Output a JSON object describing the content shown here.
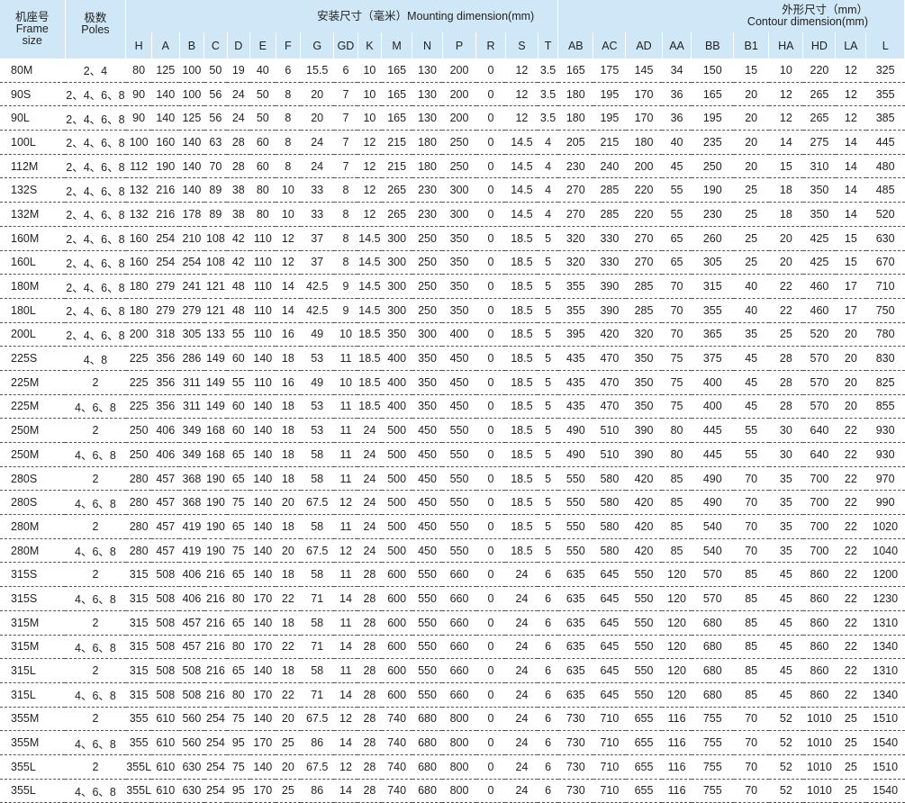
{
  "header": {
    "frame_label": "机座号\nFrame\nsize",
    "poles_label": "极数\nPoles",
    "mounting_label": "安装尺寸（毫米）Mounting dimension(mm)",
    "contour_label": "外形尺寸（mm）\nContour dimension(mm)",
    "mounting_columns": [
      "H",
      "A",
      "B",
      "C",
      "D",
      "E",
      "F",
      "G",
      "GD",
      "K",
      "M",
      "N",
      "P",
      "R",
      "S",
      "T"
    ],
    "contour_columns": [
      "AB",
      "AC",
      "AD",
      "AA",
      "BB",
      "B1",
      "HA",
      "HD",
      "LA",
      "L"
    ]
  },
  "rows": [
    [
      "80M",
      "2、4",
      "80",
      "125",
      "100",
      "50",
      "19",
      "40",
      "6",
      "15.5",
      "6",
      "10",
      "165",
      "130",
      "200",
      "0",
      "12",
      "3.5",
      "165",
      "175",
      "145",
      "34",
      "150",
      "15",
      "10",
      "220",
      "12",
      "325"
    ],
    [
      "90S",
      "2、4、6、8",
      "90",
      "140",
      "100",
      "56",
      "24",
      "50",
      "8",
      "20",
      "7",
      "10",
      "165",
      "130",
      "200",
      "0",
      "12",
      "3.5",
      "180",
      "195",
      "170",
      "36",
      "165",
      "20",
      "12",
      "265",
      "12",
      "355"
    ],
    [
      "90L",
      "2、4、6、8",
      "90",
      "140",
      "125",
      "56",
      "24",
      "50",
      "8",
      "20",
      "7",
      "10",
      "165",
      "130",
      "200",
      "0",
      "12",
      "3.5",
      "180",
      "195",
      "170",
      "36",
      "195",
      "20",
      "12",
      "265",
      "12",
      "385"
    ],
    [
      "100L",
      "2、4、6、8",
      "100",
      "160",
      "140",
      "63",
      "28",
      "60",
      "8",
      "24",
      "7",
      "12",
      "215",
      "180",
      "250",
      "0",
      "14.5",
      "4",
      "205",
      "215",
      "180",
      "40",
      "235",
      "20",
      "14",
      "275",
      "14",
      "445"
    ],
    [
      "112M",
      "2、4、6、8",
      "112",
      "190",
      "140",
      "70",
      "28",
      "60",
      "8",
      "24",
      "7",
      "12",
      "215",
      "180",
      "250",
      "0",
      "14.5",
      "4",
      "230",
      "240",
      "200",
      "45",
      "250",
      "20",
      "15",
      "310",
      "14",
      "480"
    ],
    [
      "132S",
      "2、4、6、8",
      "132",
      "216",
      "140",
      "89",
      "38",
      "80",
      "10",
      "33",
      "8",
      "12",
      "265",
      "230",
      "300",
      "0",
      "14.5",
      "4",
      "270",
      "285",
      "220",
      "55",
      "190",
      "25",
      "18",
      "350",
      "14",
      "485"
    ],
    [
      "132M",
      "2、4、6、8",
      "132",
      "216",
      "178",
      "89",
      "38",
      "80",
      "10",
      "33",
      "8",
      "12",
      "265",
      "230",
      "300",
      "0",
      "14.5",
      "4",
      "270",
      "285",
      "220",
      "55",
      "230",
      "25",
      "18",
      "350",
      "14",
      "520"
    ],
    [
      "160M",
      "2、4、6、8",
      "160",
      "254",
      "210",
      "108",
      "42",
      "110",
      "12",
      "37",
      "8",
      "14.5",
      "300",
      "250",
      "350",
      "0",
      "18.5",
      "5",
      "320",
      "330",
      "270",
      "65",
      "260",
      "25",
      "20",
      "425",
      "15",
      "630"
    ],
    [
      "160L",
      "2、4、6、8",
      "160",
      "254",
      "254",
      "108",
      "42",
      "110",
      "12",
      "37",
      "8",
      "14.5",
      "300",
      "250",
      "350",
      "0",
      "18.5",
      "5",
      "320",
      "330",
      "270",
      "65",
      "305",
      "25",
      "20",
      "425",
      "15",
      "670"
    ],
    [
      "180M",
      "2、4、6、8",
      "180",
      "279",
      "241",
      "121",
      "48",
      "110",
      "14",
      "42.5",
      "9",
      "14.5",
      "300",
      "250",
      "350",
      "0",
      "18.5",
      "5",
      "355",
      "390",
      "285",
      "70",
      "315",
      "40",
      "22",
      "460",
      "17",
      "710"
    ],
    [
      "180L",
      "2、4、6、8",
      "180",
      "279",
      "279",
      "121",
      "48",
      "110",
      "14",
      "42.5",
      "9",
      "14.5",
      "300",
      "250",
      "350",
      "0",
      "18.5",
      "5",
      "355",
      "390",
      "285",
      "70",
      "355",
      "40",
      "22",
      "460",
      "17",
      "750"
    ],
    [
      "200L",
      "2、4、6、8",
      "200",
      "318",
      "305",
      "133",
      "55",
      "110",
      "16",
      "49",
      "10",
      "18.5",
      "350",
      "300",
      "400",
      "0",
      "18.5",
      "5",
      "395",
      "420",
      "320",
      "70",
      "365",
      "35",
      "25",
      "520",
      "20",
      "780"
    ],
    [
      "225S",
      "4、8",
      "225",
      "356",
      "286",
      "149",
      "60",
      "140",
      "18",
      "53",
      "11",
      "18.5",
      "400",
      "350",
      "450",
      "0",
      "18.5",
      "5",
      "435",
      "470",
      "350",
      "75",
      "375",
      "45",
      "28",
      "570",
      "20",
      "830"
    ],
    [
      "225M",
      "2",
      "225",
      "356",
      "311",
      "149",
      "55",
      "110",
      "16",
      "49",
      "10",
      "18.5",
      "400",
      "350",
      "450",
      "0",
      "18.5",
      "5",
      "435",
      "470",
      "350",
      "75",
      "400",
      "45",
      "28",
      "570",
      "20",
      "825"
    ],
    [
      "225M",
      "4、6、8",
      "225",
      "356",
      "311",
      "149",
      "60",
      "140",
      "18",
      "53",
      "11",
      "18.5",
      "400",
      "350",
      "450",
      "0",
      "18.5",
      "5",
      "435",
      "470",
      "350",
      "75",
      "400",
      "45",
      "28",
      "570",
      "20",
      "855"
    ],
    [
      "250M",
      "2",
      "250",
      "406",
      "349",
      "168",
      "60",
      "140",
      "18",
      "53",
      "11",
      "24",
      "500",
      "450",
      "550",
      "0",
      "18.5",
      "5",
      "490",
      "510",
      "390",
      "80",
      "445",
      "55",
      "30",
      "640",
      "22",
      "930"
    ],
    [
      "250M",
      "4、6、8",
      "250",
      "406",
      "349",
      "168",
      "65",
      "140",
      "18",
      "58",
      "11",
      "24",
      "500",
      "450",
      "550",
      "0",
      "18.5",
      "5",
      "490",
      "510",
      "390",
      "80",
      "445",
      "55",
      "30",
      "640",
      "22",
      "930"
    ],
    [
      "280S",
      "2",
      "280",
      "457",
      "368",
      "190",
      "65",
      "140",
      "18",
      "58",
      "11",
      "24",
      "500",
      "450",
      "550",
      "0",
      "18.5",
      "5",
      "550",
      "580",
      "420",
      "85",
      "490",
      "70",
      "35",
      "700",
      "22",
      "970"
    ],
    [
      "280S",
      "4、6、8",
      "280",
      "457",
      "368",
      "190",
      "75",
      "140",
      "20",
      "67.5",
      "12",
      "24",
      "500",
      "450",
      "550",
      "0",
      "18.5",
      "5",
      "550",
      "580",
      "420",
      "85",
      "490",
      "70",
      "35",
      "700",
      "22",
      "990"
    ],
    [
      "280M",
      "2",
      "280",
      "457",
      "419",
      "190",
      "65",
      "140",
      "18",
      "58",
      "11",
      "24",
      "500",
      "450",
      "550",
      "0",
      "18.5",
      "5",
      "550",
      "580",
      "420",
      "85",
      "540",
      "70",
      "35",
      "700",
      "22",
      "1020"
    ],
    [
      "280M",
      "4、6、8",
      "280",
      "457",
      "419",
      "190",
      "75",
      "140",
      "20",
      "67.5",
      "12",
      "24",
      "500",
      "450",
      "550",
      "0",
      "18.5",
      "5",
      "550",
      "580",
      "420",
      "85",
      "540",
      "70",
      "35",
      "700",
      "22",
      "1040"
    ],
    [
      "315S",
      "2",
      "315",
      "508",
      "406",
      "216",
      "65",
      "140",
      "18",
      "58",
      "11",
      "28",
      "600",
      "550",
      "660",
      "0",
      "24",
      "6",
      "635",
      "645",
      "550",
      "120",
      "570",
      "85",
      "45",
      "860",
      "22",
      "1200"
    ],
    [
      "315S",
      "4、6、8",
      "315",
      "508",
      "406",
      "216",
      "80",
      "170",
      "22",
      "71",
      "14",
      "28",
      "600",
      "550",
      "660",
      "0",
      "24",
      "6",
      "635",
      "645",
      "550",
      "120",
      "570",
      "85",
      "45",
      "860",
      "22",
      "1230"
    ],
    [
      "315M",
      "2",
      "315",
      "508",
      "457",
      "216",
      "65",
      "140",
      "18",
      "58",
      "11",
      "28",
      "600",
      "550",
      "660",
      "0",
      "24",
      "6",
      "635",
      "645",
      "550",
      "120",
      "680",
      "85",
      "45",
      "860",
      "22",
      "1310"
    ],
    [
      "315M",
      "4、6、8",
      "315",
      "508",
      "457",
      "216",
      "80",
      "170",
      "22",
      "71",
      "14",
      "28",
      "600",
      "550",
      "660",
      "0",
      "24",
      "6",
      "635",
      "645",
      "550",
      "120",
      "680",
      "85",
      "45",
      "860",
      "22",
      "1340"
    ],
    [
      "315L",
      "2",
      "315",
      "508",
      "508",
      "216",
      "65",
      "140",
      "18",
      "58",
      "11",
      "28",
      "600",
      "550",
      "660",
      "0",
      "24",
      "6",
      "635",
      "645",
      "550",
      "120",
      "680",
      "85",
      "45",
      "860",
      "22",
      "1310"
    ],
    [
      "315L",
      "4、6、8",
      "315",
      "508",
      "508",
      "216",
      "80",
      "170",
      "22",
      "71",
      "14",
      "28",
      "600",
      "550",
      "660",
      "0",
      "24",
      "6",
      "635",
      "645",
      "550",
      "120",
      "680",
      "85",
      "45",
      "860",
      "22",
      "1340"
    ],
    [
      "355M",
      "2",
      "355",
      "610",
      "560",
      "254",
      "75",
      "140",
      "20",
      "67.5",
      "12",
      "28",
      "740",
      "680",
      "800",
      "0",
      "24",
      "6",
      "730",
      "710",
      "655",
      "116",
      "755",
      "70",
      "52",
      "1010",
      "25",
      "1510"
    ],
    [
      "355M",
      "4、6、8",
      "355",
      "610",
      "560",
      "254",
      "95",
      "170",
      "25",
      "86",
      "14",
      "28",
      "740",
      "680",
      "800",
      "0",
      "24",
      "6",
      "730",
      "710",
      "655",
      "116",
      "755",
      "70",
      "52",
      "1010",
      "25",
      "1540"
    ],
    [
      "355L",
      "2",
      "355L",
      "610",
      "630",
      "254",
      "75",
      "140",
      "20",
      "67.5",
      "12",
      "28",
      "740",
      "680",
      "800",
      "0",
      "24",
      "6",
      "730",
      "710",
      "655",
      "116",
      "755",
      "70",
      "52",
      "1010",
      "25",
      "1510"
    ],
    [
      "355L",
      "4、6、8",
      "355L",
      "610",
      "630",
      "254",
      "95",
      "170",
      "25",
      "86",
      "14",
      "28",
      "740",
      "680",
      "800",
      "0",
      "24",
      "6",
      "730",
      "710",
      "655",
      "116",
      "755",
      "70",
      "52",
      "1010",
      "25",
      "1540"
    ]
  ],
  "colors": {
    "header_bg": "#cfe7f7",
    "row_divider": "#555555"
  }
}
